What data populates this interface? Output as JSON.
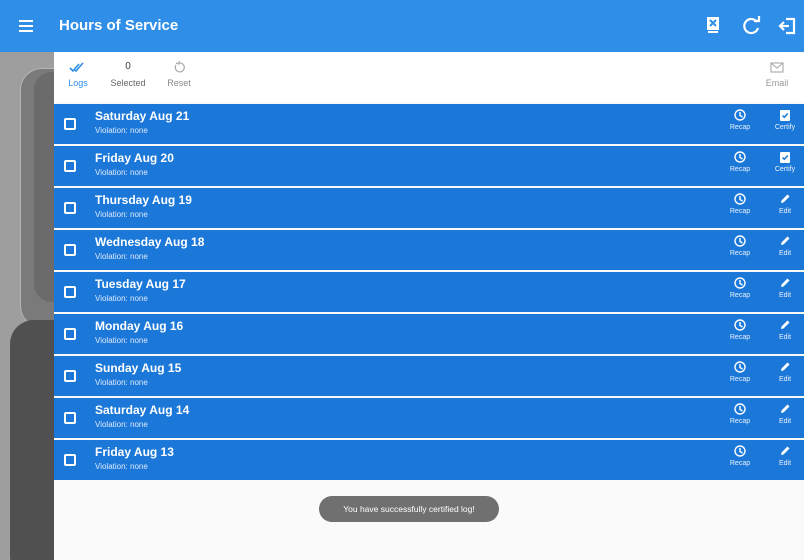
{
  "app": {
    "title": "Hours of Service"
  },
  "header": {
    "menu_icon": "hamburger-icon",
    "actions": [
      {
        "icon": "document-x-icon"
      },
      {
        "icon": "refresh-icon"
      },
      {
        "icon": "logout-icon"
      }
    ]
  },
  "toolbar": {
    "logs_label": "Logs",
    "selected_count": "0",
    "selected_label": "Selected",
    "reset_label": "Reset",
    "email_label": "Email"
  },
  "logs": [
    {
      "day": "Saturday Aug 21",
      "violation": "Violation: none",
      "recap": "Recap",
      "action": "Certify"
    },
    {
      "day": "Friday Aug 20",
      "violation": "Violation: none",
      "recap": "Recap",
      "action": "Certify"
    },
    {
      "day": "Thursday Aug 19",
      "violation": "Violation: none",
      "recap": "Recap",
      "action": "Edit"
    },
    {
      "day": "Wednesday Aug 18",
      "violation": "Violation: none",
      "recap": "Recap",
      "action": "Edit"
    },
    {
      "day": "Tuesday Aug 17",
      "violation": "Violation: none",
      "recap": "Recap",
      "action": "Edit"
    },
    {
      "day": "Monday Aug 16",
      "violation": "Violation: none",
      "recap": "Recap",
      "action": "Edit"
    },
    {
      "day": "Sunday Aug 15",
      "violation": "Violation: none",
      "recap": "Recap",
      "action": "Edit"
    },
    {
      "day": "Saturday Aug 14",
      "violation": "Violation: none",
      "recap": "Recap",
      "action": "Edit"
    },
    {
      "day": "Friday Aug 13",
      "violation": "Violation: none",
      "recap": "Recap",
      "action": "Edit"
    }
  ],
  "toast": {
    "message": "You have successfully certified log!"
  },
  "colors": {
    "appbar": "#2f8ee8",
    "row": "#1c78d8",
    "accent": "#2f8ee8"
  }
}
